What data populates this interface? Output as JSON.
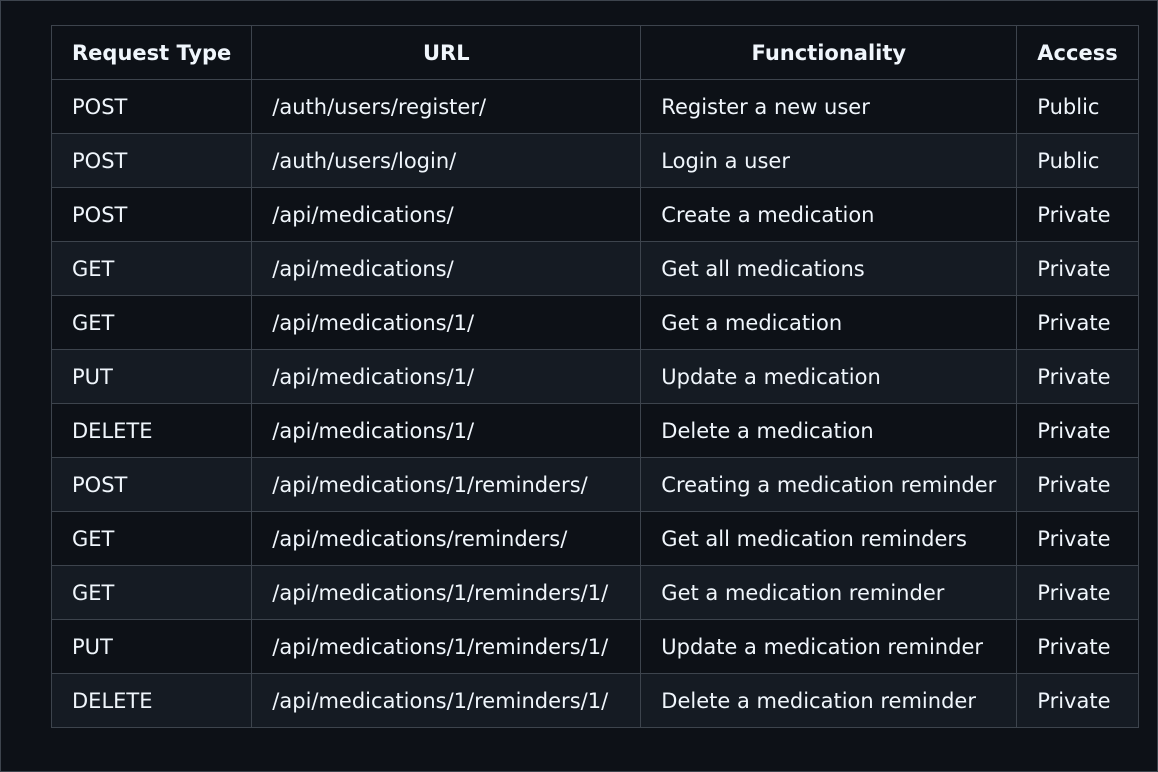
{
  "table": {
    "headers": [
      "Request Type",
      "URL",
      "Functionality",
      "Access"
    ],
    "rows": [
      {
        "type": "POST",
        "url": "/auth/users/register/",
        "functionality": "Register a new user",
        "access": "Public"
      },
      {
        "type": "POST",
        "url": "/auth/users/login/",
        "functionality": "Login a user",
        "access": "Public"
      },
      {
        "type": "POST",
        "url": "/api/medications/",
        "functionality": "Create a medication",
        "access": "Private"
      },
      {
        "type": "GET",
        "url": "/api/medications/",
        "functionality": "Get all medications",
        "access": "Private"
      },
      {
        "type": "GET",
        "url": "/api/medications/1/",
        "functionality": "Get a medication",
        "access": "Private"
      },
      {
        "type": "PUT",
        "url": "/api/medications/1/",
        "functionality": "Update a medication",
        "access": "Private"
      },
      {
        "type": "DELETE",
        "url": "/api/medications/1/",
        "functionality": "Delete a medication",
        "access": "Private"
      },
      {
        "type": "POST",
        "url": "/api/medications/1/reminders/",
        "functionality": "Creating a medication reminder",
        "access": "Private"
      },
      {
        "type": "GET",
        "url": "/api/medications/reminders/",
        "functionality": "Get all medication reminders",
        "access": "Private"
      },
      {
        "type": "GET",
        "url": "/api/medications/1/reminders/1/",
        "functionality": "Get a medication reminder",
        "access": "Private"
      },
      {
        "type": "PUT",
        "url": "/api/medications/1/reminders/1/",
        "functionality": "Update a medication reminder",
        "access": "Private"
      },
      {
        "type": "DELETE",
        "url": "/api/medications/1/reminders/1/",
        "functionality": "Delete a medication reminder",
        "access": "Private"
      }
    ]
  }
}
